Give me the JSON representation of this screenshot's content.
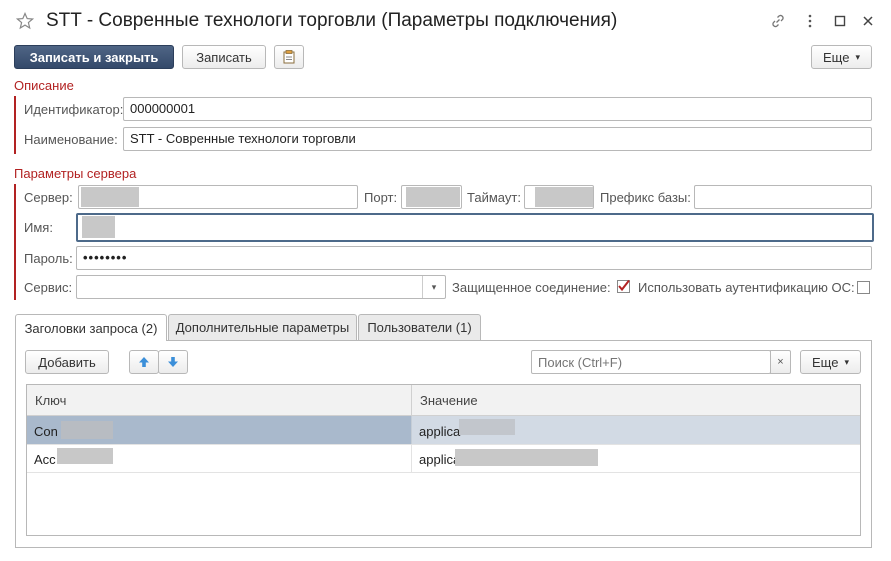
{
  "window": {
    "title": "STT - Совренные технологи торговли (Параметры подключения)"
  },
  "toolbar": {
    "save_close": "Записать и закрыть",
    "save": "Записать",
    "more": "Еще"
  },
  "description": {
    "heading": "Описание",
    "id_label": "Идентификатор:",
    "id_value": "000000001",
    "name_label": "Наименование:",
    "name_value": "STT - Совренные технологи торговли"
  },
  "server": {
    "heading": "Параметры сервера",
    "server_label": "Сервер:",
    "port_label": "Порт:",
    "timeout_label": "Таймаут:",
    "prefix_label": "Префикс базы:",
    "name_label": "Имя:",
    "password_label": "Пароль:",
    "password_value": "••••••••",
    "service_label": "Сервис:",
    "secure_label": "Защищенное соединение:",
    "secure_checked": true,
    "os_auth_label": "Использовать аутентификацию ОС:",
    "os_auth_checked": false
  },
  "tabs": [
    {
      "label": "Заголовки запроса (2)",
      "active": true
    },
    {
      "label": "Дополнительные параметры",
      "active": false
    },
    {
      "label": "Пользователи (1)",
      "active": false
    }
  ],
  "headers_panel": {
    "add_label": "Добавить",
    "search_placeholder": "Поиск (Ctrl+F)",
    "more": "Еще",
    "columns": [
      "Ключ",
      "Значение"
    ],
    "rows": [
      {
        "key": "Con",
        "value": "applica"
      },
      {
        "key": "Acc",
        "value": "applica"
      }
    ]
  },
  "colors": {
    "accent": "#b22222",
    "primary_button": "#3d5273",
    "selected_row": "#a9b9cc"
  }
}
